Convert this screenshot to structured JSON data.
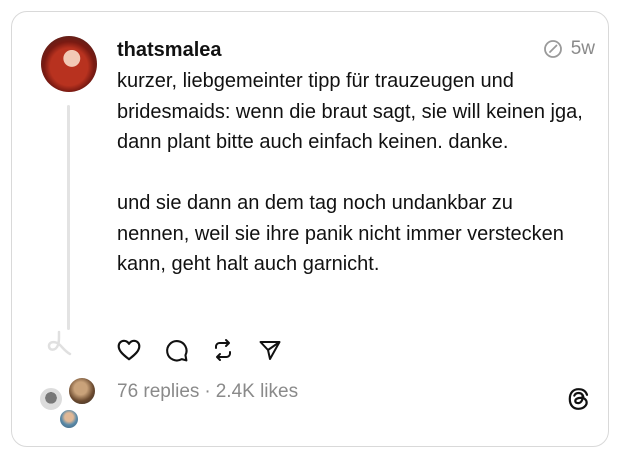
{
  "post": {
    "username": "thatsmalea",
    "time": "5w",
    "paragraphs": [
      "kurzer, liebgemeinter tipp für trauzeugen und bridesmaids: wenn die braut sagt, sie will keinen jga, dann plant bitte auch einfach keinen. danke.",
      "und sie dann an dem tag noch undankbar zu nennen, weil sie ihre panik nicht immer verstecken kann, geht halt auch garnicht."
    ]
  },
  "actions": {
    "like_icon": "heart-icon",
    "reply_icon": "comment-icon",
    "repost_icon": "repost-icon",
    "share_icon": "send-icon"
  },
  "stats": {
    "replies": "76 replies",
    "separator": "·",
    "likes": "2.4K likes"
  },
  "colors": {
    "text": "#111111",
    "muted": "#8a8a8a",
    "border": "#d9d9d9"
  }
}
